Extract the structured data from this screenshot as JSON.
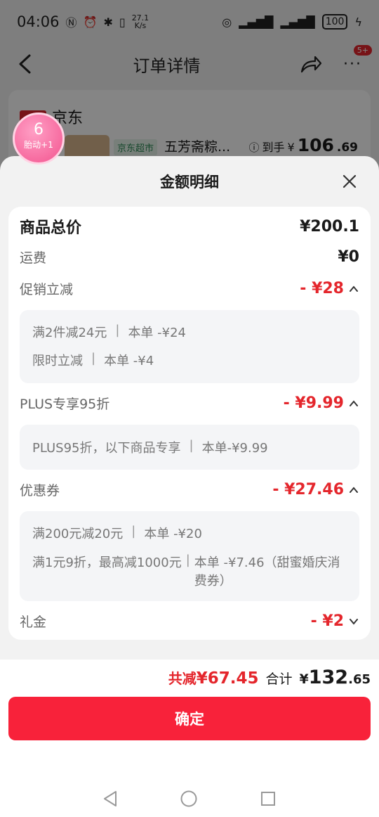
{
  "status_bar": {
    "time": "04:06",
    "net_speed_value": "27.1",
    "net_speed_unit": "K/s",
    "battery": "100"
  },
  "background_page": {
    "nav_title": "订单详情",
    "message_badge": "5+",
    "shop_name": "京东",
    "store_tag": "京东超市",
    "product_name": "五芳斋粽...",
    "price_label": "到手",
    "price_currency": "¥",
    "price_int": "106",
    "price_dec": ".69"
  },
  "fetal_bubble": {
    "count": "6",
    "text": "胎动+1"
  },
  "sheet": {
    "title": "金额明细",
    "goods_total": {
      "label": "商品总价",
      "amount": "¥200.1"
    },
    "shipping": {
      "label": "运费",
      "amount": "¥0"
    },
    "promo": {
      "label": "促销立减",
      "amount": "- ¥28",
      "lines": [
        {
          "name": "满2件减24元",
          "value": "本单 -¥24"
        },
        {
          "name": "限时立减",
          "value": "本单 -¥4"
        }
      ]
    },
    "plus": {
      "label": "PLUS专享95折",
      "amount": "- ¥9.99",
      "lines": [
        {
          "name": "PLUS95折，以下商品专享",
          "value": "本单-¥9.99"
        }
      ]
    },
    "coupon": {
      "label": "优惠券",
      "amount": "- ¥27.46",
      "lines": [
        {
          "name": "满200元减20元",
          "value": "本单 -¥20"
        },
        {
          "name": "满1元9折，最高减1000元",
          "value": "本单 -¥7.46（甜蜜婚庆消费券）"
        }
      ]
    },
    "gift": {
      "label": "礼金",
      "amount": "- ¥2"
    }
  },
  "footer": {
    "reduce_label": "共减",
    "reduce_amount": "¥67.45",
    "sum_label": "合计",
    "sum_currency": "¥",
    "sum_int": "132",
    "sum_dec": ".65",
    "confirm_label": "确定"
  },
  "colors": {
    "accent_red": "#e4262c",
    "button_red": "#f8223a",
    "bubble_pink": "#f3548f"
  }
}
